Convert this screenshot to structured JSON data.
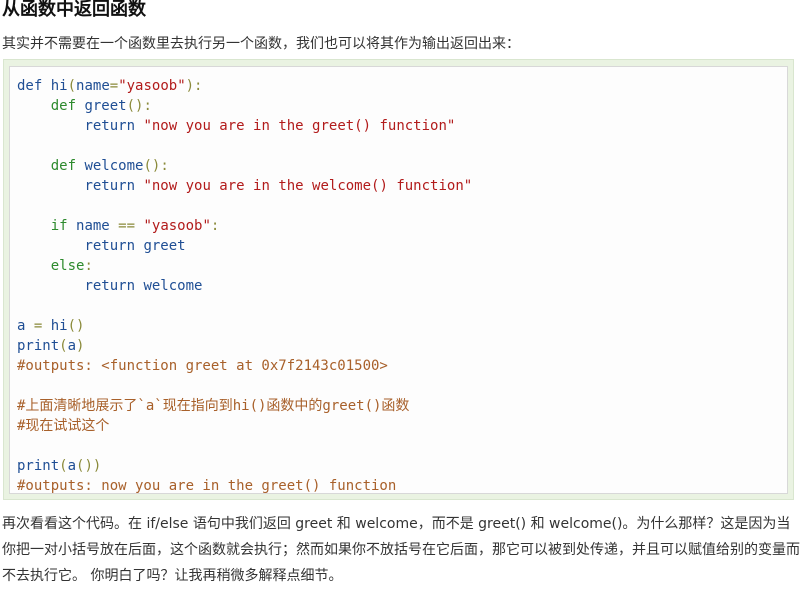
{
  "heading": "从函数中返回函数",
  "intro": "其实并不需要在一个函数里去执行另一个函数，我们也可以将其作为输出返回出来：",
  "code_lines": [
    [
      [
        "k",
        "def"
      ],
      [
        "t",
        " "
      ],
      [
        "n",
        "hi"
      ],
      [
        "p",
        "("
      ],
      [
        "n",
        "name"
      ],
      [
        "p",
        "="
      ],
      [
        "s",
        "\"yasoob\""
      ],
      [
        "p",
        "):"
      ]
    ],
    [
      [
        "t",
        "    "
      ],
      [
        "kg",
        "def"
      ],
      [
        "t",
        " "
      ],
      [
        "n",
        "greet"
      ],
      [
        "p",
        "():"
      ]
    ],
    [
      [
        "t",
        "        "
      ],
      [
        "k",
        "return"
      ],
      [
        "t",
        " "
      ],
      [
        "s",
        "\"now you are in the greet() function\""
      ]
    ],
    [],
    [
      [
        "t",
        "    "
      ],
      [
        "kg",
        "def"
      ],
      [
        "t",
        " "
      ],
      [
        "n",
        "welcome"
      ],
      [
        "p",
        "():"
      ]
    ],
    [
      [
        "t",
        "        "
      ],
      [
        "k",
        "return"
      ],
      [
        "t",
        " "
      ],
      [
        "s",
        "\"now you are in the welcome() function\""
      ]
    ],
    [],
    [
      [
        "t",
        "    "
      ],
      [
        "kg",
        "if"
      ],
      [
        "t",
        " "
      ],
      [
        "n",
        "name"
      ],
      [
        "t",
        " "
      ],
      [
        "p",
        "=="
      ],
      [
        "t",
        " "
      ],
      [
        "s",
        "\"yasoob\""
      ],
      [
        "p",
        ":"
      ]
    ],
    [
      [
        "t",
        "        "
      ],
      [
        "k",
        "return"
      ],
      [
        "t",
        " "
      ],
      [
        "n",
        "greet"
      ]
    ],
    [
      [
        "t",
        "    "
      ],
      [
        "kg",
        "else"
      ],
      [
        "p",
        ":"
      ]
    ],
    [
      [
        "t",
        "        "
      ],
      [
        "k",
        "return"
      ],
      [
        "t",
        " "
      ],
      [
        "n",
        "welcome"
      ]
    ],
    [],
    [
      [
        "n",
        "a"
      ],
      [
        "t",
        " "
      ],
      [
        "p",
        "="
      ],
      [
        "t",
        " "
      ],
      [
        "n",
        "hi"
      ],
      [
        "p",
        "()"
      ]
    ],
    [
      [
        "n",
        "print"
      ],
      [
        "p",
        "("
      ],
      [
        "n",
        "a"
      ],
      [
        "p",
        ")"
      ]
    ],
    [
      [
        "c",
        "#outputs: <function greet at 0x7f2143c01500>"
      ]
    ],
    [],
    [
      [
        "c",
        "#上面清晰地展示了`a`现在指向到hi()函数中的greet()函数"
      ]
    ],
    [
      [
        "c",
        "#现在试试这个"
      ]
    ],
    [],
    [
      [
        "n",
        "print"
      ],
      [
        "p",
        "("
      ],
      [
        "n",
        "a"
      ],
      [
        "p",
        "())"
      ]
    ],
    [
      [
        "c",
        "#outputs: now you are in the greet() function"
      ]
    ]
  ],
  "outro": "再次看看这个代码。在 if/else 语句中我们返回 greet 和 welcome，而不是 greet() 和 welcome()。为什么那样？这是因为当你把一对小括号放在后面，这个函数就会执行；然而如果你不放括号在它后面，那它可以被到处传递，并且可以赋值给别的变量而不去执行它。 你明白了吗？让我再稍微多解释点细节。"
}
